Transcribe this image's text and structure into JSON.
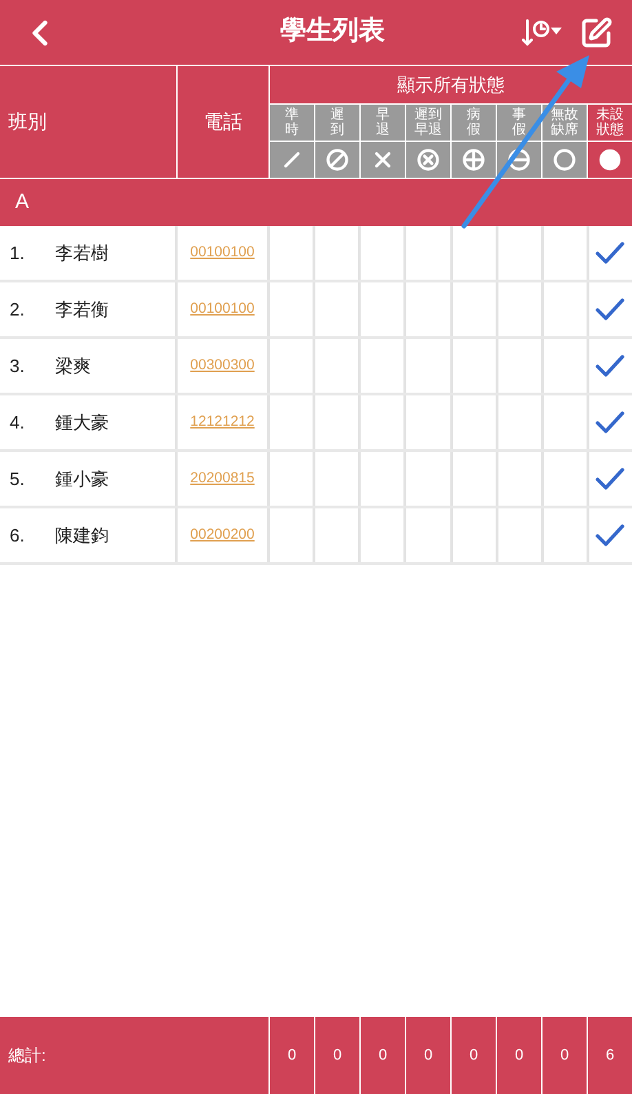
{
  "title": "學生列表",
  "header": {
    "class_label": "班別",
    "phone_label": "電話",
    "status_title": "顯示所有狀態"
  },
  "statuses": [
    {
      "label": "準時",
      "kind": "on_time"
    },
    {
      "label": "遲到",
      "kind": "late"
    },
    {
      "label": "早退",
      "kind": "early_leave"
    },
    {
      "label": "遲到早退",
      "kind": "late_early"
    },
    {
      "label": "病假",
      "kind": "sick"
    },
    {
      "label": "事假",
      "kind": "personal"
    },
    {
      "label": "無故缺席",
      "kind": "absent"
    },
    {
      "label": "未設狀態",
      "kind": "unset"
    }
  ],
  "group": "A",
  "students": [
    {
      "number": "1.",
      "name": "李若樹",
      "phone": "00100100",
      "checks": [
        false,
        false,
        false,
        false,
        false,
        false,
        false,
        true
      ]
    },
    {
      "number": "2.",
      "name": "李若衡",
      "phone": "00100100",
      "checks": [
        false,
        false,
        false,
        false,
        false,
        false,
        false,
        true
      ]
    },
    {
      "number": "3.",
      "name": "梁爽",
      "phone": "00300300",
      "checks": [
        false,
        false,
        false,
        false,
        false,
        false,
        false,
        true
      ]
    },
    {
      "number": "4.",
      "name": "鍾大豪",
      "phone": "12121212",
      "checks": [
        false,
        false,
        false,
        false,
        false,
        false,
        false,
        true
      ]
    },
    {
      "number": "5.",
      "name": "鍾小豪",
      "phone": "20200815",
      "checks": [
        false,
        false,
        false,
        false,
        false,
        false,
        false,
        true
      ]
    },
    {
      "number": "6.",
      "name": "陳建鈞",
      "phone": "00200200",
      "checks": [
        false,
        false,
        false,
        false,
        false,
        false,
        false,
        true
      ]
    }
  ],
  "footer": {
    "label": "總計:",
    "totals": [
      "0",
      "0",
      "0",
      "0",
      "0",
      "0",
      "0",
      "6"
    ]
  }
}
